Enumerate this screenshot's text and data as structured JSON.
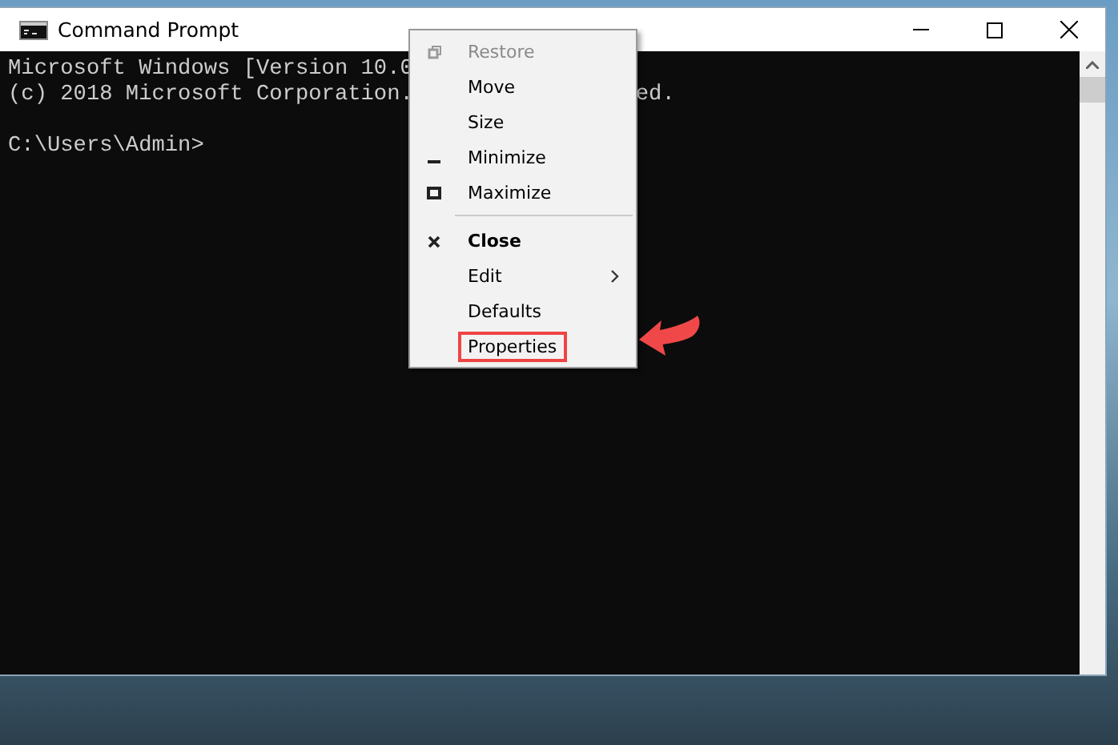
{
  "window": {
    "title": "Command Prompt"
  },
  "console": {
    "lines": [
      {
        "text": "Microsoft Windows [Version 10.0"
      },
      {
        "text": "(c) 2018 Microsoft Corporation.",
        "tail": "ed."
      },
      {
        "text": "C:\\Users\\Admin>",
        "gap_before": true
      }
    ]
  },
  "menu": {
    "items": [
      {
        "label": "Restore",
        "kind": "restore",
        "disabled": true,
        "bold": false,
        "submenu": false,
        "highlighted": false
      },
      {
        "label": "Move",
        "kind": "plain",
        "disabled": false,
        "bold": false,
        "submenu": false,
        "highlighted": false
      },
      {
        "label": "Size",
        "kind": "plain",
        "disabled": false,
        "bold": false,
        "submenu": false,
        "highlighted": false
      },
      {
        "label": "Minimize",
        "kind": "minimize",
        "disabled": false,
        "bold": false,
        "submenu": false,
        "highlighted": false
      },
      {
        "label": "Maximize",
        "kind": "maximize",
        "disabled": false,
        "bold": false,
        "submenu": false,
        "highlighted": false
      },
      {
        "kind": "separator"
      },
      {
        "label": "Close",
        "kind": "close",
        "disabled": false,
        "bold": true,
        "submenu": false,
        "highlighted": false
      },
      {
        "label": "Edit",
        "kind": "plain",
        "disabled": false,
        "bold": false,
        "submenu": true,
        "highlighted": false
      },
      {
        "label": "Defaults",
        "kind": "plain",
        "disabled": false,
        "bold": false,
        "submenu": false,
        "highlighted": false
      },
      {
        "label": "Properties",
        "kind": "plain",
        "disabled": false,
        "bold": false,
        "submenu": false,
        "highlighted": true
      }
    ]
  }
}
